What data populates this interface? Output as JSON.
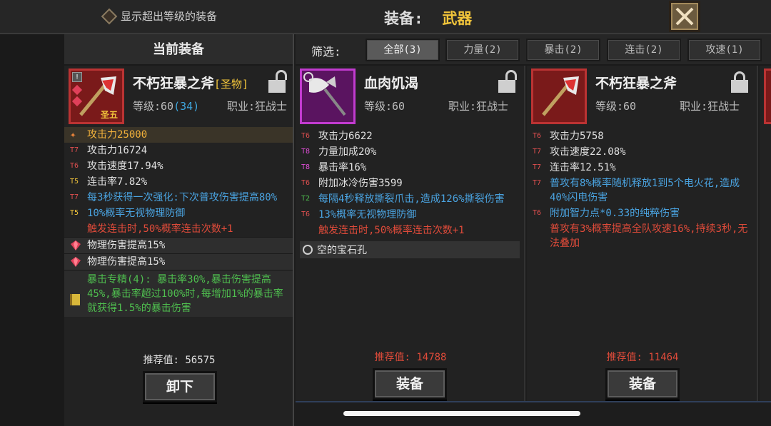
{
  "header": {
    "show_higher_label": "显示超出等级的装备",
    "title_label": "装备:",
    "title_value": "武器"
  },
  "current": {
    "header": "当前装备",
    "name": "不朽狂暴之斧",
    "quality": "[圣物]",
    "level_label": "等级:60",
    "level_extra": "(34)",
    "class_label": "职业:狂战士",
    "badge": "圣五",
    "stats": [
      {
        "tier": "",
        "text": "攻击力25000",
        "color": "gold"
      },
      {
        "tier": "T7",
        "text": "攻击力16724",
        "color": "white"
      },
      {
        "tier": "T6",
        "text": "攻击速度17.94%",
        "color": "white"
      },
      {
        "tier": "T5",
        "text": "连击率7.82%",
        "color": "white"
      },
      {
        "tier": "T7",
        "text": "每3秒获得一次强化:下次普攻伤害提高80%",
        "color": "blue"
      },
      {
        "tier": "T5",
        "text": "10%概率无视物理防御",
        "color": "blue"
      },
      {
        "tier": "",
        "text": "触发连击时,50%概率连击次数+1",
        "color": "red"
      }
    ],
    "gems": [
      "物理伤害提高15%",
      "物理伤害提高15%"
    ],
    "set_text": "暴击专精(4): 暴击率30%,暴击伤害提高45%,暴击率超过100%时,每增加1%的暴击率就获得1.5%的暴击伤害",
    "recommend": "推荐值: 56575",
    "unequip": "卸下"
  },
  "filter": {
    "label": "筛选:",
    "tabs": [
      "全部(3)",
      "力量(2)",
      "暴击(2)",
      "连击(2)",
      "攻速(1)"
    ]
  },
  "cards": [
    {
      "name": "血肉饥渴",
      "level_label": "等级:60",
      "class_label": "职业:狂战士",
      "stats": [
        {
          "tier": "T6",
          "text": "攻击力6622",
          "color": "white"
        },
        {
          "tier": "T8",
          "text": "力量加成20%",
          "color": "white"
        },
        {
          "tier": "T8",
          "text": "暴击率16%",
          "color": "white"
        },
        {
          "tier": "T6",
          "text": "附加冰冷伤害3599",
          "color": "white"
        },
        {
          "tier": "T2",
          "text": "每隔4秒释放撕裂爪击,造成126%撕裂伤害",
          "color": "blue"
        },
        {
          "tier": "T6",
          "text": "13%概率无视物理防御",
          "color": "blue"
        },
        {
          "tier": "",
          "text": "触发连击时,50%概率连击次数+1",
          "color": "red"
        }
      ],
      "empty_slot": "空的宝石孔",
      "recommend": "推荐值: 14788",
      "equip": "装备"
    },
    {
      "name": "不朽狂暴之斧",
      "level_label": "等级:60",
      "class_label": "职业:狂战士",
      "stats": [
        {
          "tier": "T6",
          "text": "攻击力5758",
          "color": "white"
        },
        {
          "tier": "T7",
          "text": "攻击速度22.08%",
          "color": "white"
        },
        {
          "tier": "T7",
          "text": "连击率12.51%",
          "color": "white"
        },
        {
          "tier": "T7",
          "text": "普攻有8%概率随机释放1到5个电火花,造成40%闪电伤害",
          "color": "blue"
        },
        {
          "tier": "T6",
          "text": "附加智力点*0.33的纯粹伤害",
          "color": "blue"
        },
        {
          "tier": "",
          "text": "普攻有3%概率提高全队攻速16%,持续3秒,无法叠加",
          "color": "red"
        }
      ],
      "recommend": "推荐值: 11464",
      "equip": "装备"
    }
  ],
  "colors": {
    "gold": "#f2c53b",
    "blue": "#4aa3e0",
    "red": "#e04b3a",
    "green": "#4fbf4f"
  }
}
